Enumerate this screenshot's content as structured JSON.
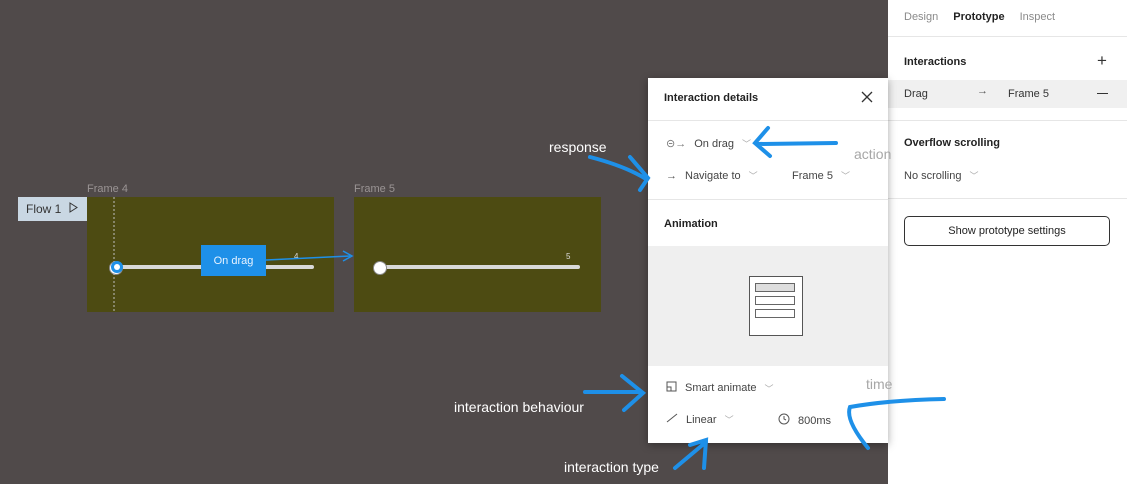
{
  "canvas": {
    "flow_label": "Flow 1",
    "frames": [
      {
        "label": "Frame 4",
        "slider_value": "4",
        "chip_text": "On drag"
      },
      {
        "label": "Frame 5",
        "slider_value": "5"
      }
    ]
  },
  "sidebar": {
    "tabs": [
      "Design",
      "Prototype",
      "Inspect"
    ],
    "active_tab": "Prototype",
    "interactions_title": "Interactions",
    "interaction": {
      "trigger": "Drag",
      "target": "Frame 5"
    },
    "overflow_title": "Overflow scrolling",
    "overflow_value": "No scrolling",
    "settings_button": "Show prototype settings"
  },
  "modal": {
    "title": "Interaction details",
    "trigger": "On drag",
    "action": "Navigate to",
    "destination": "Frame 5",
    "animation_title": "Animation",
    "animation_type": "Smart animate",
    "easing": "Linear",
    "duration": "800ms"
  },
  "annotations": {
    "response": "response",
    "action": "action",
    "behaviour": "interaction behaviour",
    "time": "time",
    "type": "interaction type"
  },
  "colors": {
    "canvas": "#504a4a",
    "frame": "#4d4b12",
    "accent": "#1e90e8",
    "annotation_arrow": "#1e90e8"
  }
}
